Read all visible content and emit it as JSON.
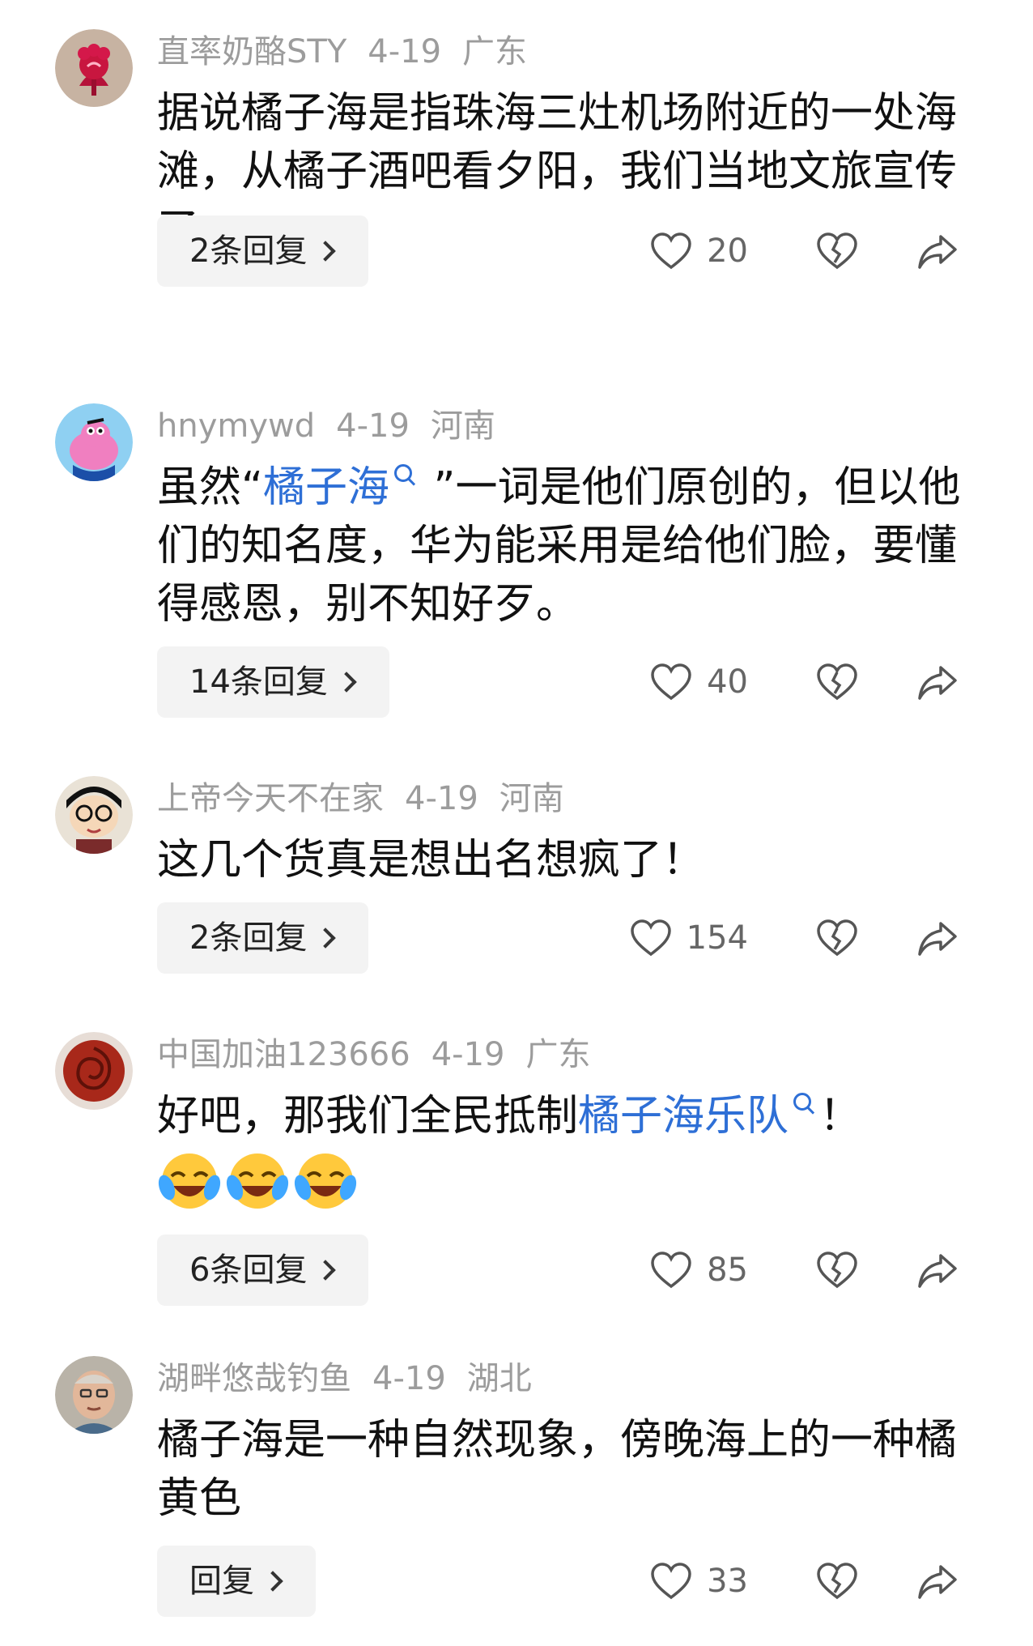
{
  "comments": [
    {
      "user": "直率奶酪STY",
      "date": "4-19",
      "region": "广东",
      "text": "据说橘子海是指珠海三灶机场附近的一处海滩，从橘子酒吧看夕阳，我们当地文旅宣传了",
      "reply_label": "2条回复",
      "likes": "20",
      "avatar_icon": "red-flower-avatar"
    },
    {
      "user": "hnymywd",
      "date": "4-19",
      "region": "河南",
      "text_before": "虽然“",
      "link": "橘子海",
      "text_after": " ”一词是他们原创的，但以他们的知名度，华为能采用是给他们脸，要懂得感恩，别不知好歹。",
      "reply_label": "14条回复",
      "likes": "40",
      "avatar_icon": "pink-cartoon-avatar"
    },
    {
      "user": "上帝今天不在家",
      "date": "4-19",
      "region": "河南",
      "text": "这几个货真是想出名想疯了！",
      "reply_label": "2条回复",
      "likes": "154",
      "avatar_icon": "cartoon-boy-avatar"
    },
    {
      "user": "中国加油123666",
      "date": "4-19",
      "region": "广东",
      "text_before": "好吧，那我们全民抵制",
      "link": "橘子海乐队",
      "text_after": "！",
      "emojis": [
        "laughing-crying-emoji",
        "laughing-crying-emoji",
        "laughing-crying-emoji"
      ],
      "reply_label": "6条回复",
      "likes": "85",
      "avatar_icon": "rose-avatar"
    },
    {
      "user": "湖畔悠哉钓鱼",
      "date": "4-19",
      "region": "湖北",
      "text": "橘子海是一种自然现象，傍晚海上的一种橘黄色",
      "reply_label": "回复",
      "likes": "33",
      "avatar_icon": "elderly-man-avatar"
    }
  ],
  "colors": {
    "link": "#2e6fd6",
    "meta": "#9c9c9c",
    "reply_bg": "#f3f3f3"
  }
}
